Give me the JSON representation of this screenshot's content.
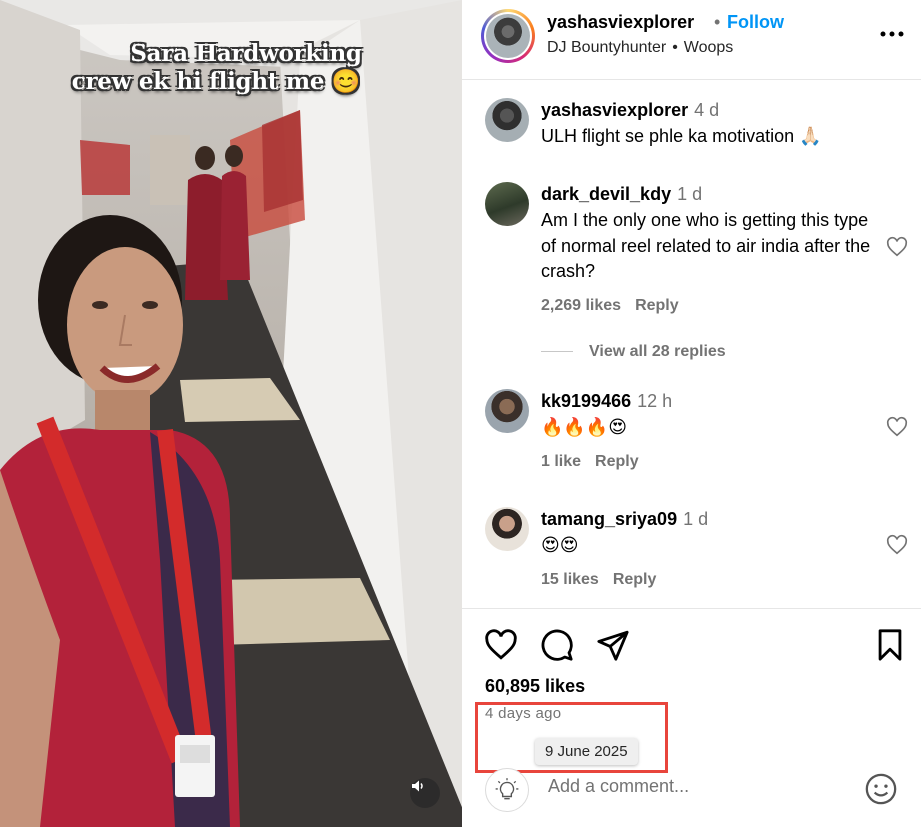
{
  "post": {
    "caption_line1": "Sara Hardworking",
    "caption_line2": "crew ek hi flight me 😊"
  },
  "header": {
    "username": "yashasviexplorer",
    "dot": "•",
    "follow_label": "Follow",
    "audio_artist": "DJ Bountyhunter",
    "audio_sep": "•",
    "audio_title": "Woops"
  },
  "comments": [
    {
      "username": "yashasviexplorer",
      "time": "4 d",
      "text": "ULH flight se phle ka motivation 🙏🏻"
    },
    {
      "username": "dark_devil_kdy",
      "time": "1 d",
      "text": "Am I the only one who is getting this type of normal reel related to air india after the crash?",
      "likes": "2,269 likes",
      "reply": "Reply",
      "view_replies": "View all 28 replies"
    },
    {
      "username": "kk9199466",
      "time": "12 h",
      "text": "🔥🔥🔥😍",
      "likes": "1 like",
      "reply": "Reply"
    },
    {
      "username": "tamang_sriya09",
      "time": "1 d",
      "text": "😍😍",
      "likes": "15 likes",
      "reply": "Reply"
    }
  ],
  "footer": {
    "likes": "60,895 likes",
    "posted_ago": "4 days ago",
    "date_tooltip": "9 June 2025",
    "comment_placeholder": "Add a comment..."
  },
  "colors": {
    "accent": "#0095f6",
    "highlight_box": "#e8453c",
    "muted_text": "#737373"
  },
  "icons": [
    "more-icon",
    "heart-icon",
    "comment-icon",
    "share-icon",
    "bookmark-icon",
    "emoji-icon",
    "lightbulb-icon",
    "sound-icon"
  ]
}
